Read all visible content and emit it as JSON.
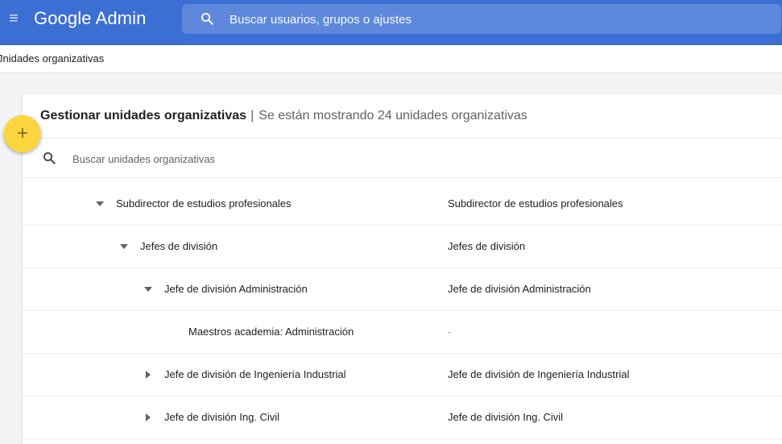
{
  "header": {
    "brand": "Google Admin",
    "search_placeholder": "Buscar usuarios, grupos o ajustes",
    "menu_icon": "hamburger-menu-icon",
    "search_icon": "search-icon"
  },
  "breadcrumb": "Jnidades organizativas",
  "card": {
    "title": "Gestionar unidades organizativas",
    "separator": "|",
    "subtitle": "Se están mostrando 24 unidades organizativas",
    "search_placeholder": "Buscar unidades organizativas"
  },
  "fab": {
    "icon": "plus-icon",
    "label": "+"
  },
  "rows": [
    {
      "name": "Subdirector de estudios profesionales",
      "description": "Subdirector de estudios profesionales",
      "toggle": "expanded"
    },
    {
      "name": "Jefes de división",
      "description": "Jefes de división",
      "toggle": "expanded"
    },
    {
      "name": "Jefe de división Administración",
      "description": "Jefe de división Administración",
      "toggle": "expanded"
    },
    {
      "name": "Maestros academia: Administración",
      "description": "-",
      "toggle": "none"
    },
    {
      "name": "Jefe de división de Ingeniería Industrial",
      "description": "Jefe de división de Ingeniería Industrial",
      "toggle": "collapsed"
    },
    {
      "name": "Jefe de división Ing. Civil",
      "description": "Jefe de división Ing. Civil",
      "toggle": "collapsed"
    }
  ],
  "colors": {
    "header_bg": "#3b6fd3",
    "search_bg": "#5d88db",
    "fab": "#fbd53d",
    "page_bg": "#f1f3f4"
  }
}
